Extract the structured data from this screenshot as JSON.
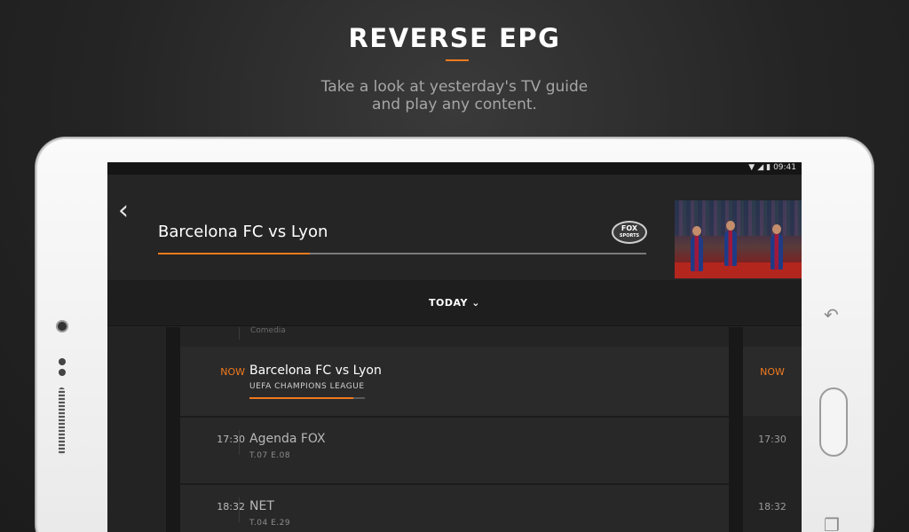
{
  "hero": {
    "title": "REVERSE EPG",
    "subtitle_line1": "Take a look at yesterday's TV guide",
    "subtitle_line2": "and play any content."
  },
  "status_bar": {
    "time": "09:41",
    "icons": [
      "wifi-icon",
      "signal-icon",
      "battery-icon"
    ]
  },
  "player": {
    "title": "Barcelona FC vs Lyon",
    "progress": 0.31,
    "channel_logo_line1": "FOX",
    "channel_logo_line2": "SPORTS"
  },
  "day_selector": {
    "label": "TODAY"
  },
  "guide": {
    "previous_genre": "Comedia",
    "rows": [
      {
        "time": "NOW",
        "title": "Barcelona FC vs Lyon",
        "subtitle": "UEFA CHAMPIONS LEAGUE",
        "progress": 0.9,
        "right_time": "NOW"
      },
      {
        "time": "17:30",
        "title": "Agenda FOX",
        "subtitle": "T.07 E.08",
        "right_time": "17:30"
      },
      {
        "time": "18:32",
        "title": "NET",
        "subtitle": "T.04 E.29",
        "right_time": "18:32"
      }
    ]
  },
  "colors": {
    "accent": "#f07a1e",
    "screen_bg": "#262626",
    "frame": "#f2f2f2"
  }
}
